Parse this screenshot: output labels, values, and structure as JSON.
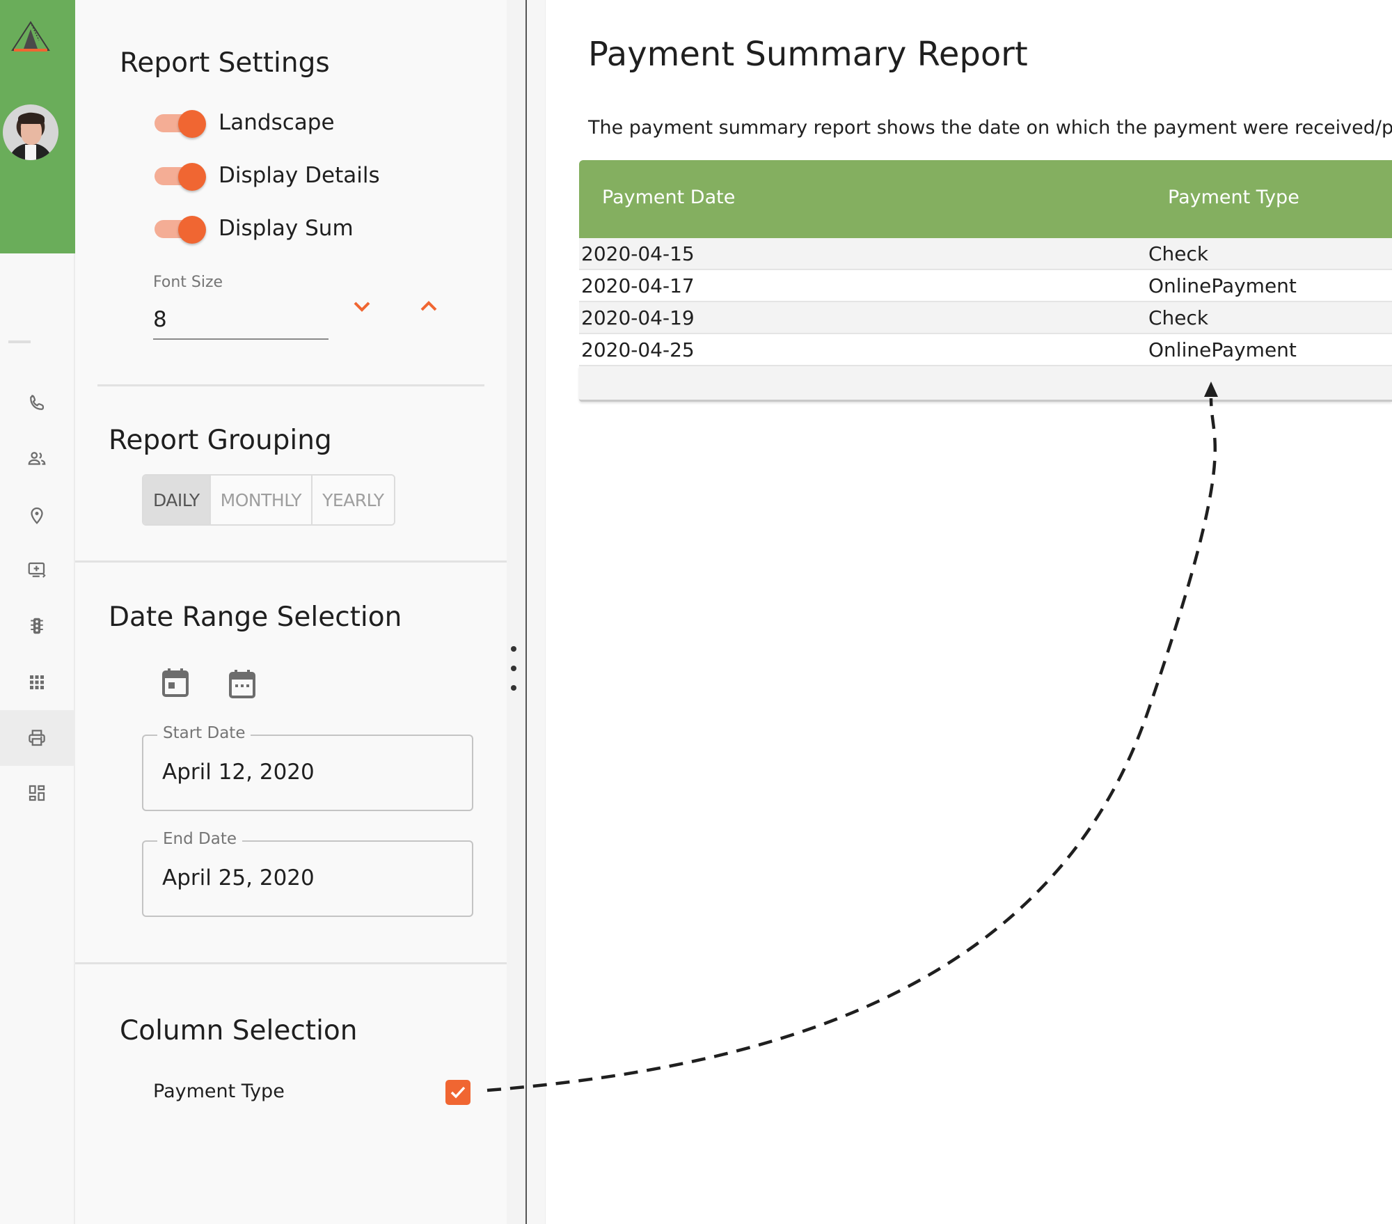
{
  "sidebar": {
    "brand_colors": {
      "header_bg": "#6aad5a",
      "accent": "#f06632"
    },
    "logo_icon": "tent-logo-icon",
    "avatar": "user-avatar",
    "items": [
      {
        "icon": "phone-icon",
        "active": false
      },
      {
        "icon": "users-icon",
        "active": false
      },
      {
        "icon": "location-pin-icon",
        "active": false
      },
      {
        "icon": "monitor-add-icon",
        "active": false
      },
      {
        "icon": "traffic-light-icon",
        "active": false
      },
      {
        "icon": "grid-apps-icon",
        "active": false
      },
      {
        "icon": "printer-icon",
        "active": true
      },
      {
        "icon": "dashboard-icon",
        "active": false
      }
    ]
  },
  "settings": {
    "title": "Report Settings",
    "toggles": [
      {
        "label": "Landscape",
        "on": true
      },
      {
        "label": "Display Details",
        "on": true
      },
      {
        "label": "Display Sum",
        "on": true
      }
    ],
    "font_size": {
      "label": "Font Size",
      "value": "8"
    }
  },
  "grouping": {
    "title": "Report Grouping",
    "options": [
      {
        "label": "DAILY",
        "active": true
      },
      {
        "label": "MONTHLY",
        "active": false
      },
      {
        "label": "YEARLY",
        "active": false
      }
    ]
  },
  "date_range": {
    "title": "Date Range Selection",
    "start": {
      "label": "Start Date",
      "value": "April 12, 2020"
    },
    "end": {
      "label": "End Date",
      "value": "April 25, 2020"
    }
  },
  "columns": {
    "title": "Column Selection",
    "items": [
      {
        "label": "Payment Type",
        "checked": true
      }
    ]
  },
  "main": {
    "title": "Payment Summary Report",
    "description": "The payment summary report shows the date on which the payment were received/payme",
    "table": {
      "header_color": "#84af60",
      "headers": [
        "Payment Date",
        "Payment Type"
      ],
      "rows": [
        [
          "2020-04-15",
          "Check"
        ],
        [
          "2020-04-17",
          "OnlinePayment"
        ],
        [
          "2020-04-19",
          "Check"
        ],
        [
          "2020-04-25",
          "OnlinePayment"
        ]
      ]
    }
  }
}
